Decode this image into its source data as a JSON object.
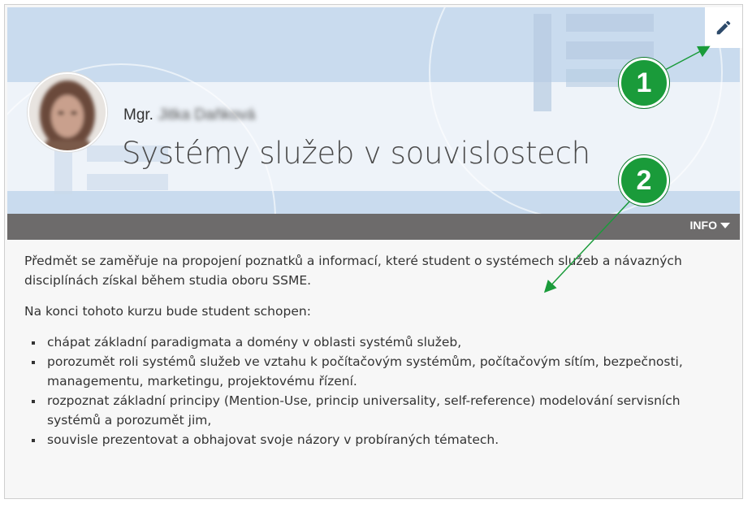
{
  "header": {
    "title_prefix": "Mgr.",
    "teacher_name": "Jitka Daňková",
    "course_title": "Systémy služeb v souvislostech"
  },
  "toolbar": {
    "edit_icon": "pencil-icon",
    "info_label": "INFO"
  },
  "description": {
    "intro": "Předmět se zaměřuje na propojení poznatků a informací, které student o systémech služeb a návazných disciplínách získal během studia oboru SSME.",
    "outcomes_lead": "Na konci tohoto kurzu bude student schopen:",
    "outcomes": [
      "chápat základní paradigmata a domény v oblasti systémů služeb,",
      "porozumět roli systémů služeb ve vztahu k počítačovým systémům, počítačovým sítím, bezpečnosti, managementu, marketingu, projektovému řízení.",
      "rozpoznat základní principy (Mention-Use, princip universality, self-reference) modelování servisních systémů a porozumět jim,",
      "souvisle prezentovat a obhajovat svoje názory v probíraných tématech."
    ]
  },
  "annotations": {
    "marker_1": "1",
    "marker_2": "2",
    "color": "#1a9b3a"
  },
  "colors": {
    "banner_blue": "#c9dbee",
    "info_bar": "#6d6b6b"
  }
}
